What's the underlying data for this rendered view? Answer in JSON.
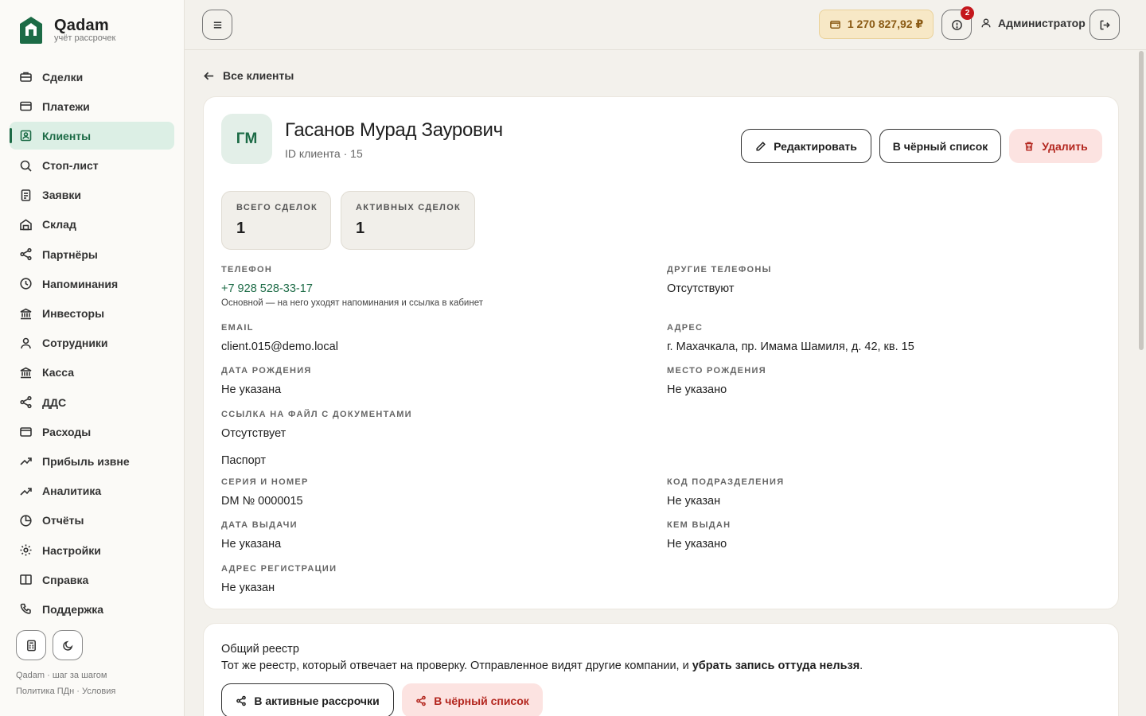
{
  "brand": {
    "name": "Qadam",
    "tagline": "учёт рассрочек",
    "accent": "#1c6b46"
  },
  "sidebar": {
    "items": [
      {
        "label": "Сделки",
        "icon": "briefcase-icon"
      },
      {
        "label": "Платежи",
        "icon": "credit-card-icon"
      },
      {
        "label": "Клиенты",
        "icon": "contact-icon",
        "active": true
      },
      {
        "label": "Стоп-лист",
        "icon": "search-icon"
      },
      {
        "label": "Заявки",
        "icon": "document-icon"
      },
      {
        "label": "Склад",
        "icon": "warehouse-icon"
      },
      {
        "label": "Партнёры",
        "icon": "share-icon"
      },
      {
        "label": "Напоминания",
        "icon": "clock-icon"
      },
      {
        "label": "Инвесторы",
        "icon": "bank-icon"
      },
      {
        "label": "Сотрудники",
        "icon": "user-icon"
      },
      {
        "label": "Касса",
        "icon": "bank-icon"
      },
      {
        "label": "ДДС",
        "icon": "share-icon"
      },
      {
        "label": "Расходы",
        "icon": "wallet-icon"
      },
      {
        "label": "Прибыль извне",
        "icon": "trending-up-icon"
      },
      {
        "label": "Аналитика",
        "icon": "trending-up-icon"
      },
      {
        "label": "Отчёты",
        "icon": "pie-chart-icon"
      },
      {
        "label": "Настройки",
        "icon": "gear-icon"
      },
      {
        "label": "Справка",
        "icon": "book-icon"
      },
      {
        "label": "Поддержка",
        "icon": "phone-icon"
      }
    ],
    "footer_line1": "Qadam · шаг за шагом",
    "footer_line2": "Политика ПДн · Условия"
  },
  "topbar": {
    "balance": "1 270 827,92 ₽",
    "notifications_count": "2",
    "user_name": "Администратор"
  },
  "back_link": "Все клиенты",
  "client": {
    "initials": "ГМ",
    "name": "Гасанов Мурад Заурович",
    "id_text": "ID клиента · 15",
    "edit_label": "Редактировать",
    "blacklist_label": "В чёрный список",
    "delete_label": "Удалить",
    "stats": [
      {
        "label": "ВСЕГО СДЕЛОК",
        "value": "1"
      },
      {
        "label": "АКТИВНЫХ СДЕЛОК",
        "value": "1"
      }
    ],
    "phone_label": "ТЕЛЕФОН",
    "phone_value": "+7 928 528-33-17",
    "phone_note": "Основной — на него уходят напоминания и ссылка в кабинет",
    "other_phones_label": "ДРУГИЕ ТЕЛЕФОНЫ",
    "other_phones_value": "Отсутствуют",
    "email_label": "EMAIL",
    "email_value": "client.015@demo.local",
    "address_label": "АДРЕС",
    "address_value": "г. Махачкала, пр. Имама Шамиля, д. 42, кв. 15",
    "birth_date_label": "ДАТА РОЖДЕНИЯ",
    "birth_date_value": "Не указана",
    "birth_place_label": "МЕСТО РОЖДЕНИЯ",
    "birth_place_value": "Не указано",
    "docs_link_label": "ССЫЛКА НА ФАЙЛ С ДОКУМЕНТАМИ",
    "docs_link_value": "Отсутствует",
    "passport_title": "Паспорт",
    "series_label": "СЕРИЯ И НОМЕР",
    "series_value": "DM № 0000015",
    "division_label": "КОД ПОДРАЗДЕЛЕНИЯ",
    "division_value": "Не указан",
    "issue_date_label": "ДАТА ВЫДАЧИ",
    "issue_date_value": "Не указана",
    "issued_by_label": "КЕМ ВЫДАН",
    "issued_by_value": "Не указано",
    "reg_address_label": "АДРЕС РЕГИСТРАЦИИ",
    "reg_address_value": "Не указан"
  },
  "registry": {
    "title": "Общий реестр",
    "desc_plain": "Тот же реестр, который отвечает на проверку. Отправленное видят другие компании, и ",
    "desc_bold": "убрать запись оттуда нельзя",
    "desc_end": ".",
    "active_btn": "В активные рассрочки",
    "blacklist_btn": "В чёрный список"
  }
}
